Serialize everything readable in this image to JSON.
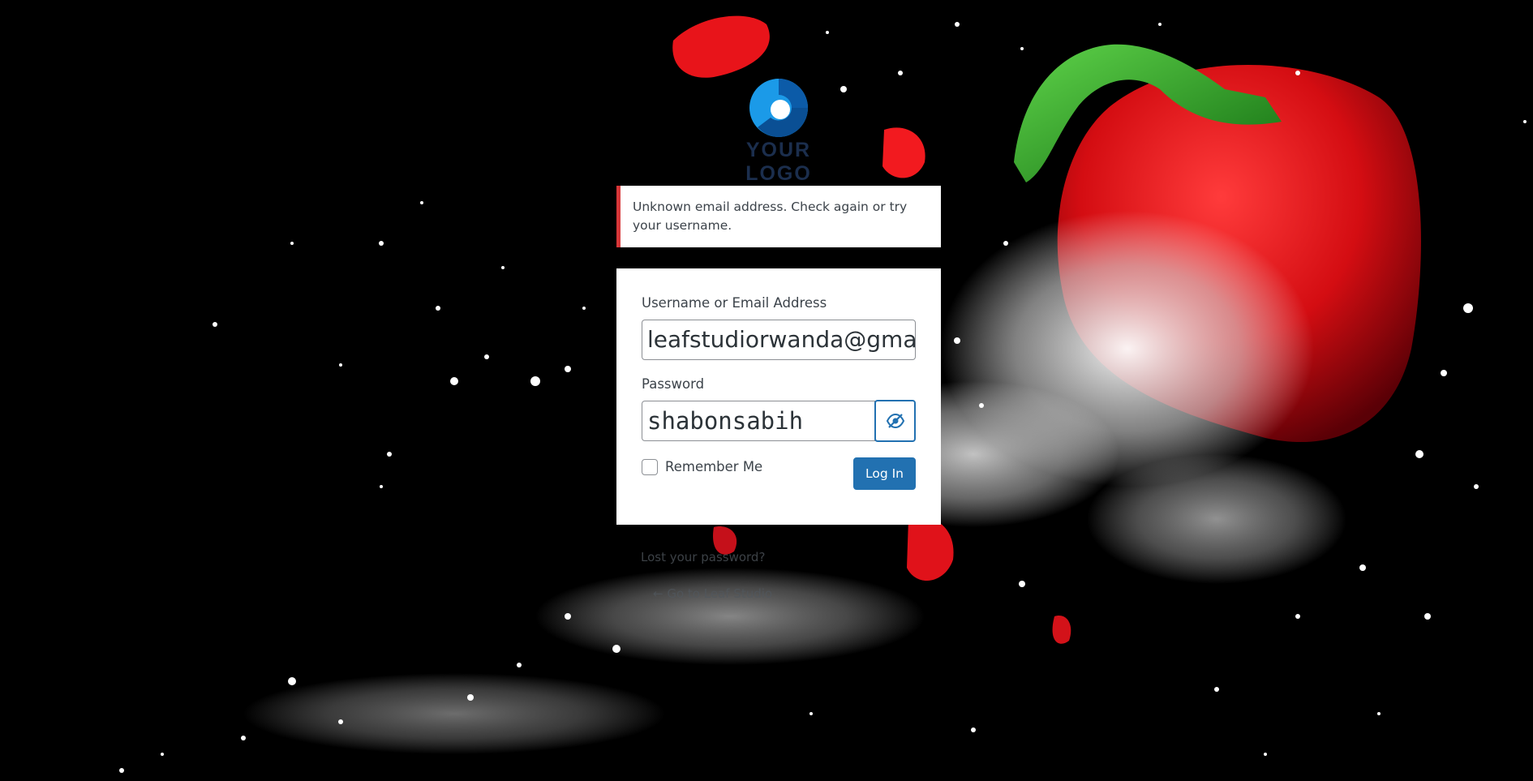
{
  "logo": {
    "text": "YOUR LOGO",
    "colors": {
      "light": "#1b9ae8",
      "dark": "#0c5ba8"
    }
  },
  "notice": {
    "message": "Unknown email address. Check again or try your username.",
    "border_color": "#d63638"
  },
  "form": {
    "username_label": "Username or Email Address",
    "username_value": "leafstudiorwanda@gma",
    "password_label": "Password",
    "password_value": "shabonsabih",
    "show_password_icon": "eye-slash-icon",
    "remember_label": "Remember Me",
    "login_button": "Log In",
    "accent_color": "#2271b1"
  },
  "links": {
    "lost_password": "Lost your password?",
    "back_to_site": "← Go to Leaf Studio"
  }
}
